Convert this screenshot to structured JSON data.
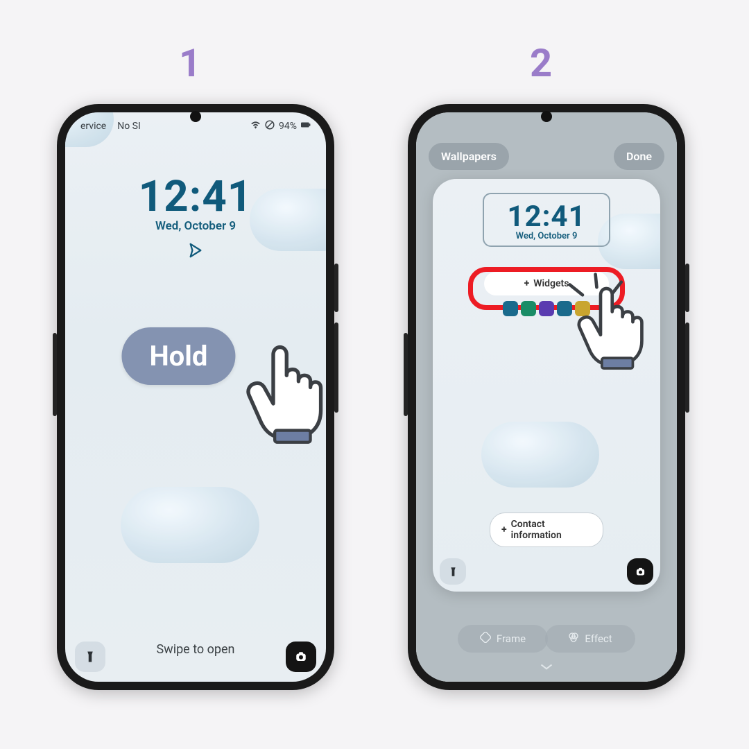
{
  "steps": {
    "one": "1",
    "two": "2"
  },
  "colors": {
    "accent": "#9a7cc9",
    "clock": "#105a7b",
    "hold": "#8493b1",
    "highlight": "#ed1c24"
  },
  "phone1": {
    "status": {
      "carrier": "ervice",
      "sim": "No SI",
      "battery": "94%"
    },
    "clock": "12:41",
    "date": "Wed, October 9",
    "hold": "Hold",
    "swipe": "Swipe to open"
  },
  "phone2": {
    "wallpapers": "Wallpapers",
    "done": "Done",
    "clock": "12:41",
    "date": "Wed, October 9",
    "widgets": "Widgets",
    "contact": "Contact information",
    "frame": "Frame",
    "effect": "Effect"
  }
}
